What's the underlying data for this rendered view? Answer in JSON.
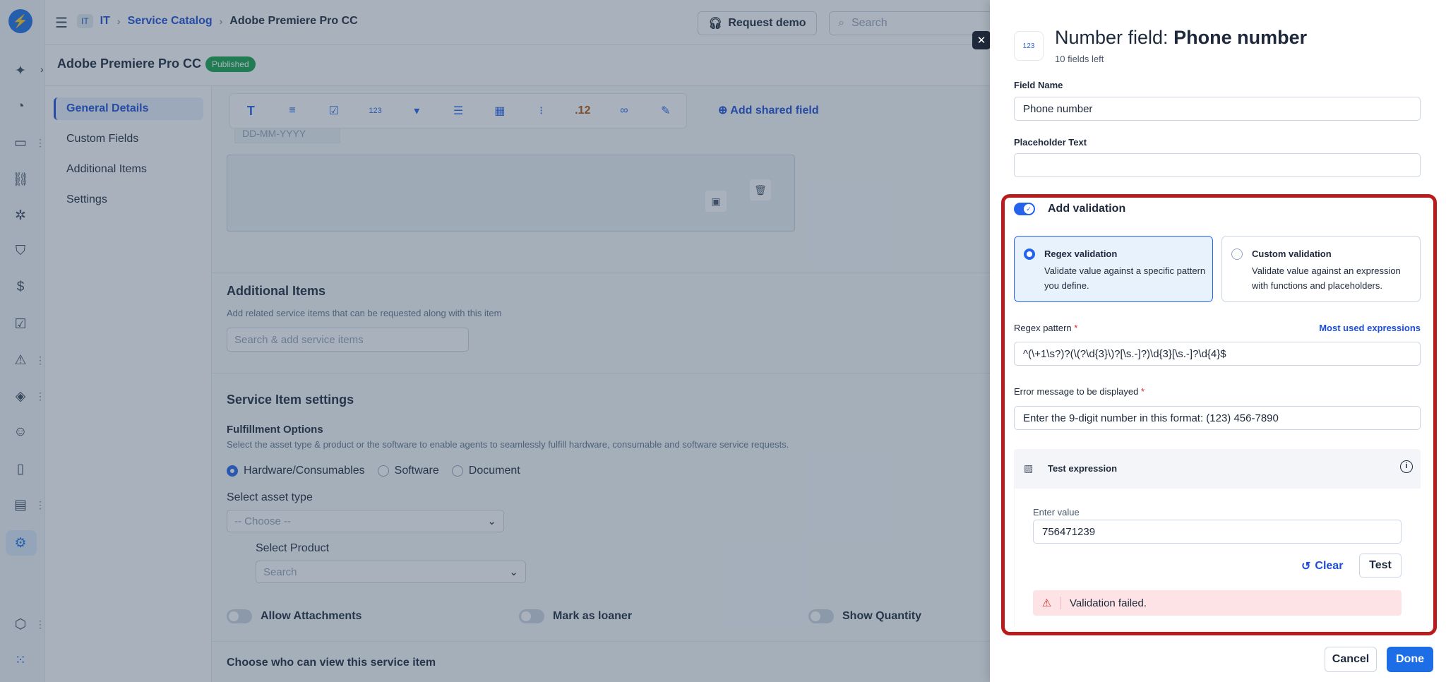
{
  "topbar": {
    "breadcrumb": {
      "badge": "IT",
      "workspace": "IT",
      "catalog": "Service Catalog",
      "current": "Adobe Premiere Pro CC"
    },
    "request_demo": "Request demo",
    "search_placeholder": "Search"
  },
  "item": {
    "title": "Adobe Premiere Pro CC",
    "status": "Published"
  },
  "side_nav": [
    "General Details",
    "Custom Fields",
    "Additional Items",
    "Settings"
  ],
  "field_toolbar": {
    "icons": [
      "text-icon",
      "paragraph-icon",
      "checkbox-icon",
      "number-icon",
      "dropdown-icon",
      "multiline-icon",
      "date-icon",
      "list-icon",
      "decimal-icon",
      "link-icon",
      "edit-icon"
    ],
    "number_label": "123",
    "decimal_label": ".12",
    "add_shared": "Add shared field"
  },
  "date_placeholder": "DD-MM-YYYY",
  "additional_items": {
    "title": "Additional Items",
    "subtitle": "Add related service items that can be requested along with this item",
    "search_placeholder": "Search & add service items"
  },
  "service_settings": {
    "title": "Service Item settings",
    "fulfillment_title": "Fulfillment Options",
    "fulfillment_desc": "Select the asset type & product or the software to enable agents to seamlessly fulfill hardware, consumable and software service requests.",
    "options": [
      "Hardware/Consumables",
      "Software",
      "Document"
    ],
    "selected_option": "Hardware/Consumables",
    "asset_type_label": "Select asset type",
    "asset_type_value": "-- Choose --",
    "product_label": "Select Product",
    "product_placeholder": "Search",
    "toggles": [
      "Allow Attachments",
      "Mark as loaner",
      "Show Quantity"
    ],
    "visibility_title": "Choose who can view this service item"
  },
  "drawer": {
    "icon_label": "123",
    "title_prefix": "Number field:",
    "title_name": "Phone number",
    "fields_left": "10 fields left",
    "field_name_label": "Field Name",
    "field_name_value": "Phone number",
    "placeholder_label": "Placeholder Text",
    "placeholder_value": "",
    "validation_label": "Add validation",
    "validation_on": true,
    "regex_option": {
      "title": "Regex validation",
      "desc": "Validate value against a specific pattern you define."
    },
    "custom_option": {
      "title": "Custom validation",
      "desc": "Validate value against an expression with functions and placeholders."
    },
    "regex_label": "Regex pattern",
    "regex_link": "Most used expressions",
    "regex_value": "^(\\+1\\s?)?(\\(?\\d{3}\\)?[\\s.-]?)\\d{3}[\\s.-]?\\d{4}$",
    "error_label": "Error message to be displayed",
    "error_value": "Enter the 9-digit number in this format: (123) 456-7890",
    "required_mark": "*",
    "test": {
      "title": "Test expression",
      "value_label": "Enter value",
      "value": "756471239",
      "clear": "Clear",
      "test_button": "Test",
      "result": "Validation failed."
    },
    "cancel": "Cancel",
    "done": "Done"
  },
  "colors": {
    "accent": "#1d6ee6",
    "highlight_frame": "#b91c1c",
    "published": "#16a34a",
    "error_bg": "#fde3e6"
  }
}
